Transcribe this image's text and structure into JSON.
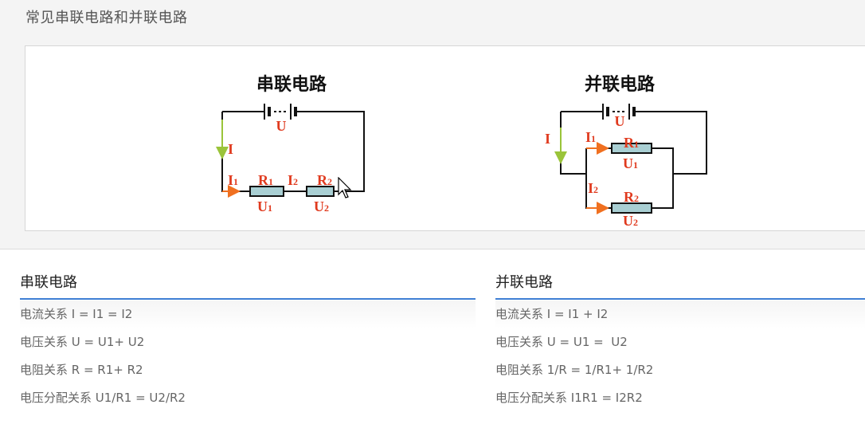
{
  "page": {
    "title": "常见串联电路和并联电路"
  },
  "figure": {
    "series": {
      "title": "串联电路",
      "labels": {
        "battery": "U",
        "current": "I",
        "i1": "I",
        "i1_sub": "1",
        "i2": "I",
        "i2_sub": "2",
        "r1": "R",
        "r1_sub": "1",
        "r2": "R",
        "r2_sub": "2",
        "u1": "U",
        "u1_sub": "1",
        "u2": "U",
        "u2_sub": "2"
      }
    },
    "parallel": {
      "title": "并联电路",
      "labels": {
        "battery": "U",
        "current": "I",
        "i1": "I",
        "i1_sub": "1",
        "i2": "I",
        "i2_sub": "2",
        "r1": "R",
        "r1_sub": "1",
        "r2": "R",
        "r2_sub": "2",
        "u1": "U",
        "u1_sub": "1",
        "u2": "U",
        "u2_sub": "2"
      }
    },
    "colors": {
      "wire": "#111111",
      "label": "#e03a1e",
      "current_arrow": "#9ac43a",
      "branch_arrow": "#f07020",
      "resistor": "#a9cfd3"
    }
  },
  "series_panel": {
    "heading": "串联电路",
    "rows": [
      "电流关系 I = I1 = I2",
      "电压关系 U = U1+ U2",
      "电阻关系 R = R1+ R2",
      "电压分配关系 U1/R1 = U2/R2"
    ]
  },
  "parallel_panel": {
    "heading": "并联电路",
    "rows": [
      "电流关系 I = I1 + I2",
      "电压关系 U = U1 =  U2",
      "电阻关系 1/R = 1/R1+ 1/R2",
      "电压分配关系 I1R1 = I2R2"
    ]
  },
  "accent_color": "#3f7fd4"
}
